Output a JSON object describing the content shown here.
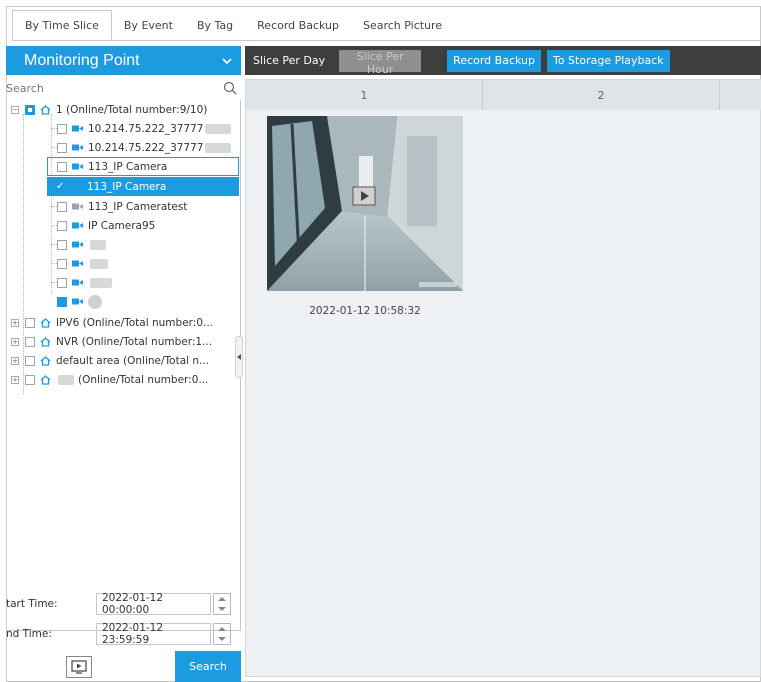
{
  "tabs": [
    {
      "label": "By Time Slice",
      "active": true
    },
    {
      "label": "By Event",
      "active": false
    },
    {
      "label": "By Tag",
      "active": false
    },
    {
      "label": "Record Backup",
      "active": false
    },
    {
      "label": "Search Picture",
      "active": false
    }
  ],
  "left_panel": {
    "title": "Monitoring Point",
    "search_placeholder": "Search",
    "tree": {
      "root": "1 (Online/Total number:9/10)",
      "cameras": [
        "10.214.75.222_37777",
        "10.214.75.222_37777",
        "113_IP Camera",
        "113_IP Camera",
        "113_IP Cameratest",
        "IP Camera95"
      ],
      "areas": [
        "IPV6 (Online/Total number:0...",
        "NVR (Online/Total number:1...",
        "default area (Online/Total n...",
        "(Online/Total number:0..."
      ]
    },
    "start_time_label": "tart Time:",
    "start_time_value": "2022-01-12 00:00:00",
    "end_time_label": "nd Time:",
    "end_time_value": "2022-01-12 23:59:59",
    "search_button": "Search"
  },
  "toolbar": {
    "slice_per_day": "Slice Per Day",
    "slice_per_hour": "Slice Per Hour",
    "record_backup": "Record Backup",
    "to_storage_playback": "To Storage Playback"
  },
  "grid": {
    "columns": [
      "1",
      "2"
    ],
    "thumbnail_time": "2022-01-12 10:58:32"
  },
  "colors": {
    "accent": "#1d9be0",
    "toolbar_bg": "#3e3e3e"
  }
}
